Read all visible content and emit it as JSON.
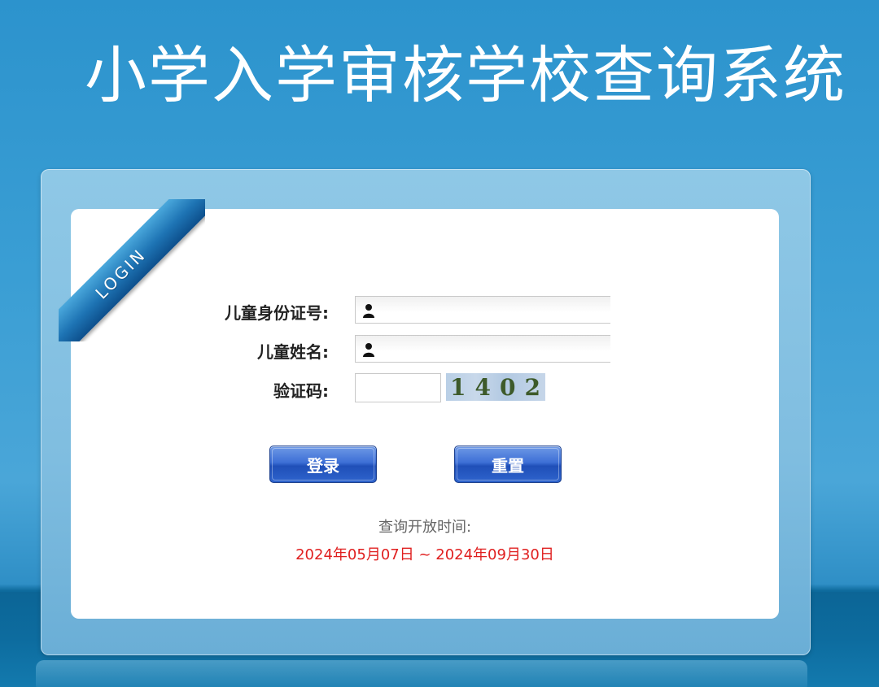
{
  "header": {
    "title": "小学入学审核学校查询系统"
  },
  "ribbon": {
    "label": "LOGIN"
  },
  "form": {
    "id_label": "儿童身份证号:",
    "id_value": "",
    "name_label": "儿童姓名:",
    "name_value": "",
    "captcha_label": "验证码:",
    "captcha_value": "",
    "captcha_image_text": "1402"
  },
  "icons": {
    "id_field_icon": "user-icon",
    "name_field_icon": "user-icon"
  },
  "buttons": {
    "login_label": "登录",
    "reset_label": "重置"
  },
  "schedule": {
    "caption": "查询开放时间:",
    "range": "2024年05月07日 ~ 2024年09月30日"
  },
  "colors": {
    "background": "#2c93cd",
    "button": "#2e63cc",
    "range_text": "#e02020"
  }
}
